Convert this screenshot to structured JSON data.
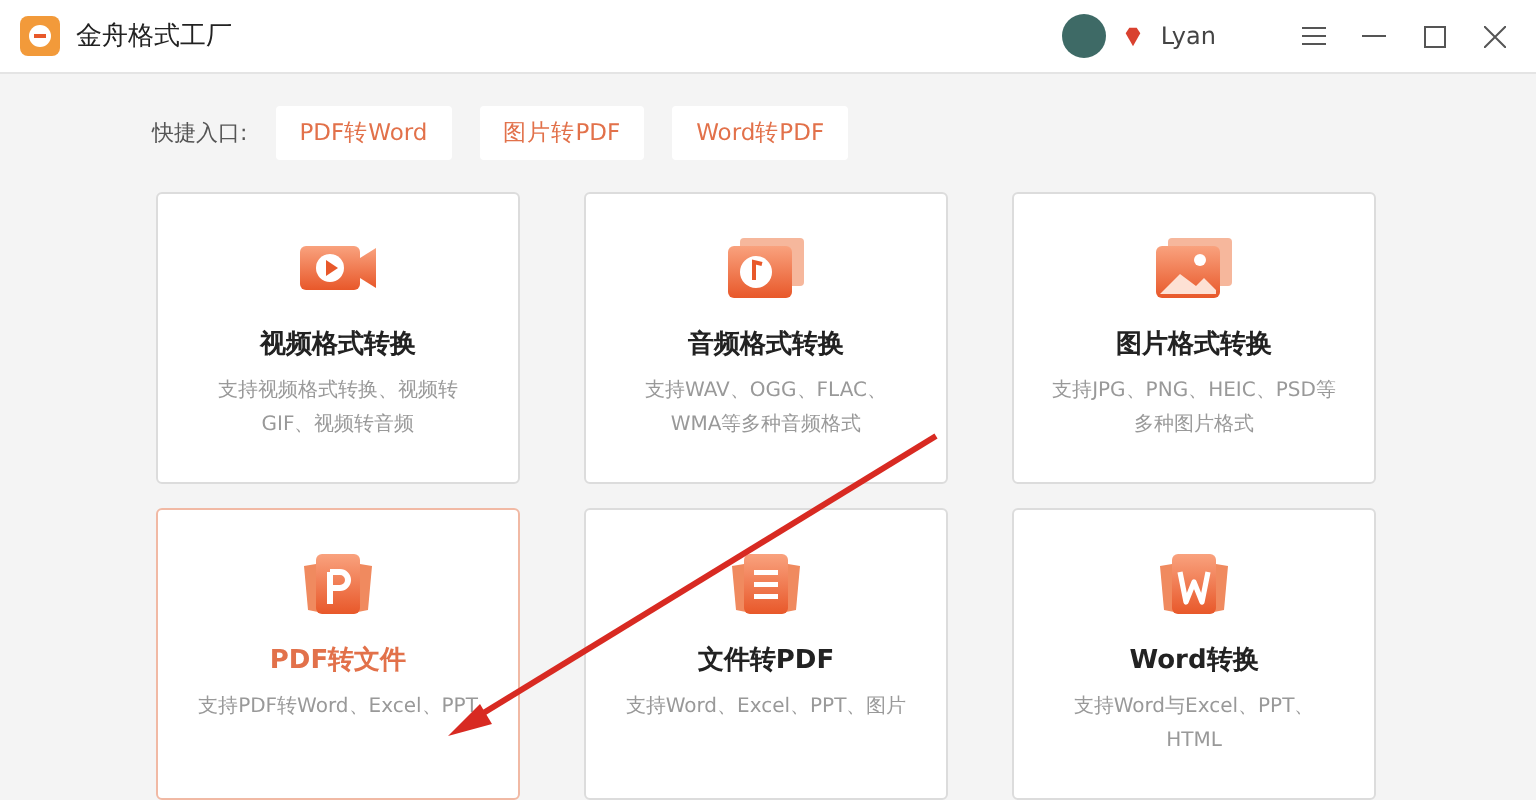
{
  "window": {
    "title": "金舟格式工厂",
    "user": "Lyan"
  },
  "shortcuts": {
    "label": "快捷入口:",
    "items": [
      "PDF转Word",
      "图片转PDF",
      "Word转PDF"
    ]
  },
  "cards": [
    {
      "kind": "video",
      "title": "视频格式转换",
      "desc": "支持视频格式转换、视频转GIF、视频转音频",
      "selected": false
    },
    {
      "kind": "audio",
      "title": "音频格式转换",
      "desc": "支持WAV、OGG、FLAC、WMA等多种音频格式",
      "selected": false
    },
    {
      "kind": "image",
      "title": "图片格式转换",
      "desc": "支持JPG、PNG、HEIC、PSD等多种图片格式",
      "selected": false
    },
    {
      "kind": "pdf",
      "title": "PDF转文件",
      "desc": "支持PDF转Word、Excel、PPT",
      "selected": true
    },
    {
      "kind": "doc",
      "title": "文件转PDF",
      "desc": "支持Word、Excel、PPT、图片",
      "selected": false
    },
    {
      "kind": "word",
      "title": "Word转换",
      "desc": "支持Word与Excel、PPT、HTML",
      "selected": false
    }
  ]
}
